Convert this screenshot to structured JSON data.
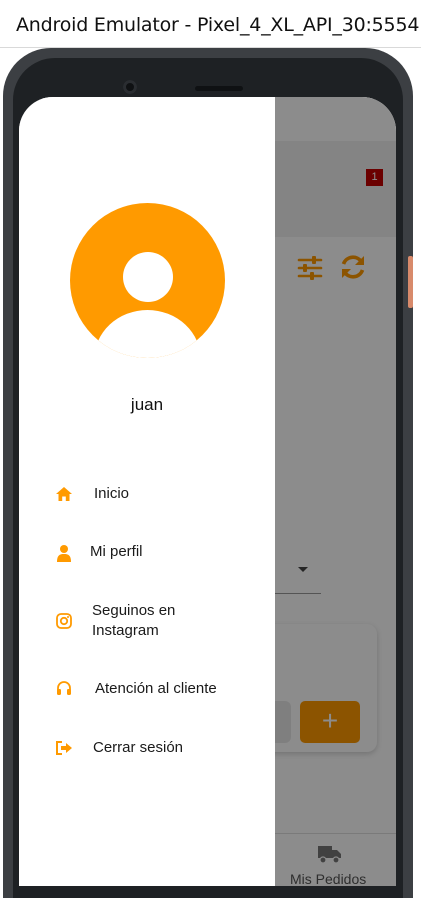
{
  "window": {
    "title": "Android Emulator - Pixel_4_XL_API_30:5554"
  },
  "background_app": {
    "notification_count": "1",
    "add_button_label": "+",
    "bottom_nav_label": "Mis Pedidos"
  },
  "drawer": {
    "username": "juan",
    "menu": [
      {
        "label": "Inicio",
        "icon": "home-icon"
      },
      {
        "label": "Mi perfil",
        "icon": "user-icon"
      },
      {
        "label_line1": "Seguinos en",
        "label_line2": "Instagram",
        "icon": "instagram-icon"
      },
      {
        "label": "Atención al cliente",
        "icon": "headset-icon"
      },
      {
        "label": "Cerrar sesión",
        "icon": "logout-icon"
      }
    ]
  },
  "colors": {
    "accent": "#ff9a00",
    "badge": "#c40000"
  }
}
